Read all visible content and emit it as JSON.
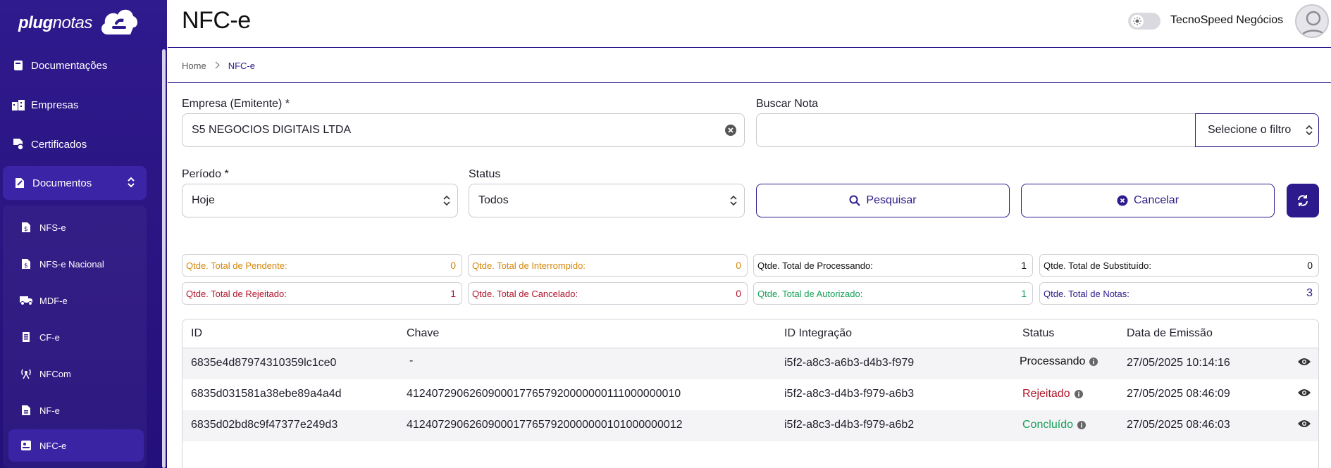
{
  "brand": {
    "logo_bold": "plug",
    "logo_light": "notas"
  },
  "sidebar": {
    "items": [
      {
        "label": "Documentações",
        "icon": "book-icon"
      },
      {
        "label": "Empresas",
        "icon": "buildings-icon"
      },
      {
        "label": "Certificados",
        "icon": "certificate-icon"
      }
    ],
    "group": {
      "label": "Documentos",
      "icon": "documents-icon",
      "expanded": true
    },
    "sub_items": [
      {
        "label": "NFS-e",
        "icon": "dollar-document-icon"
      },
      {
        "label": "NFS-e Nacional",
        "icon": "dollar-document-icon"
      },
      {
        "label": "MDF-e",
        "icon": "truck-icon"
      },
      {
        "label": "CF-e",
        "icon": "receipt-icon"
      },
      {
        "label": "NFCom",
        "icon": "antenna-icon"
      },
      {
        "label": "NF-e",
        "icon": "file-icon"
      },
      {
        "label": "NFC-e",
        "icon": "id-card-icon",
        "active": true
      }
    ]
  },
  "header": {
    "title": "NFC-e",
    "account_name": "TecnoSpeed Negócios"
  },
  "breadcrumb": {
    "home": "Home",
    "current": "NFC-e"
  },
  "form": {
    "empresa_label": "Empresa (Emitente) *",
    "empresa_value": "S5 NEGOCIOS DIGITAIS LTDA",
    "buscar_label": "Buscar Nota",
    "buscar_value": "",
    "filtro_value": "Selecione o filtro",
    "periodo_label": "Período *",
    "periodo_value": "Hoje",
    "status_label": "Status",
    "status_value": "Todos",
    "pesquisar_label": "Pesquisar",
    "cancelar_label": "Cancelar"
  },
  "stats": [
    {
      "label": "Qtde. Total de Pendente:",
      "value": "0",
      "color": "#d4870b"
    },
    {
      "label": "Qtde. Total de Interrompido:",
      "value": "0",
      "color": "#d4870b"
    },
    {
      "label": "Qtde. Total de Processando:",
      "value": "1",
      "color": "#111111"
    },
    {
      "label": "Qtde. Total de Substituído:",
      "value": "0",
      "color": "#111111"
    },
    {
      "label": "Qtde. Total de Rejeitado:",
      "value": "1",
      "color": "#b0162b"
    },
    {
      "label": "Qtde. Total de Cancelado:",
      "value": "0",
      "color": "#b0162b"
    },
    {
      "label": "Qtde. Total de Autorizado:",
      "value": "1",
      "color": "#16a05a"
    },
    {
      "label": "Qtde. Total de Notas:",
      "value": "3",
      "color": "#2d1a8c"
    }
  ],
  "table": {
    "columns": [
      "ID",
      "Chave",
      "ID Integração",
      "Status",
      "Data de Emissão"
    ],
    "rows": [
      {
        "id": "6835e4d87974310359lc1ce0",
        "chave": "-",
        "id_integracao": "i5f2-a8c3-a6b3-d4b3-f979",
        "status": "Processando",
        "status_color": "#111111",
        "data": "27/05/2025 10:14:16"
      },
      {
        "id": "6835d031581a38ebe89a4a4d",
        "chave": "41240729062609000177657920000000111000000010",
        "id_integracao": "i5f2-a8c3-d4b3-f979-a6b3",
        "status": "Rejeitado",
        "status_color": "#b0162b",
        "data": "27/05/2025 08:46:09"
      },
      {
        "id": "6835d02bd8c9f47377e249d3",
        "chave": "41240729062609000177657920000000101000000012",
        "id_integracao": "i5f2-a8c3-d4b3-f979-a6b2",
        "status": "Concluído",
        "status_color": "#16a05a",
        "data": "27/05/2025 08:46:03"
      }
    ]
  },
  "colors": {
    "primary": "#2d1a8c",
    "sidebar": "#2a1480"
  }
}
